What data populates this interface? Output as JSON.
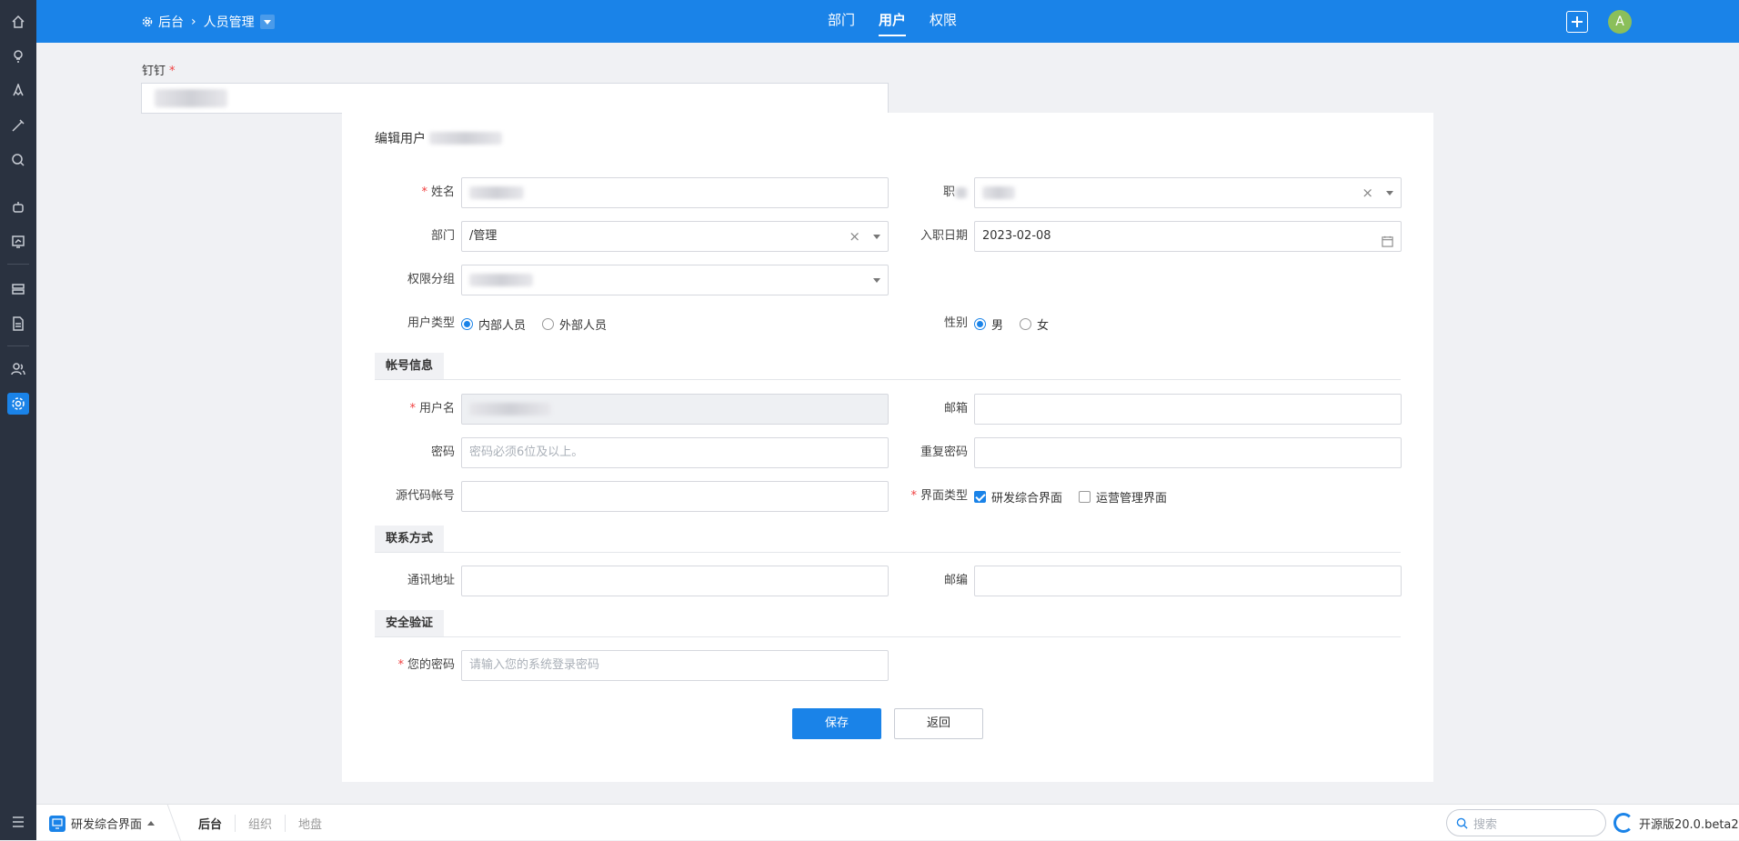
{
  "topbar": {
    "breadcrumb_root": "后台",
    "breadcrumb_current": "人员管理",
    "tabs": [
      {
        "label": "部门",
        "active": false
      },
      {
        "label": "用户",
        "active": true
      },
      {
        "label": "权限",
        "active": false
      }
    ],
    "avatar_letter": "A"
  },
  "background_form": {
    "label": "钉钉",
    "required": "*"
  },
  "panel": {
    "title": "编辑用户",
    "fields": {
      "name_label": "姓名",
      "post_label": "职",
      "dept_label": "部门",
      "dept_value": "/管理",
      "hire_date_label": "入职日期",
      "hire_date_value": "2023-02-08",
      "perm_group_label": "权限分组",
      "user_type_label": "用户类型",
      "user_type_options": [
        "内部人员",
        "外部人员"
      ],
      "gender_label": "性别",
      "gender_options": [
        "男",
        "女"
      ]
    },
    "sections": {
      "account": "帐号信息",
      "contact": "联系方式",
      "security": "安全验证"
    },
    "account": {
      "username_label": "用户名",
      "email_label": "邮箱",
      "password_label": "密码",
      "password_placeholder": "密码必须6位及以上。",
      "repeat_password_label": "重复密码",
      "source_account_label": "源代码帐号",
      "ui_type_label": "界面类型",
      "ui_type_options": [
        "研发综合界面",
        "运营管理界面"
      ]
    },
    "contact": {
      "address_label": "通讯地址",
      "zip_label": "邮编"
    },
    "security": {
      "your_password_label": "您的密码",
      "your_password_placeholder": "请输入您的系统登录密码"
    },
    "buttons": {
      "save": "保存",
      "back": "返回"
    }
  },
  "bottombar": {
    "mode": "研发综合界面",
    "tabs": [
      {
        "label": "后台",
        "active": true
      },
      {
        "label": "组织",
        "active": false
      },
      {
        "label": "地盘",
        "active": false
      }
    ],
    "search_placeholder": "搜索",
    "version": "开源版20.0.beta2"
  },
  "colors": {
    "primary": "#1a83e8",
    "nav_bg": "#2a3240",
    "required": "#f04040"
  }
}
